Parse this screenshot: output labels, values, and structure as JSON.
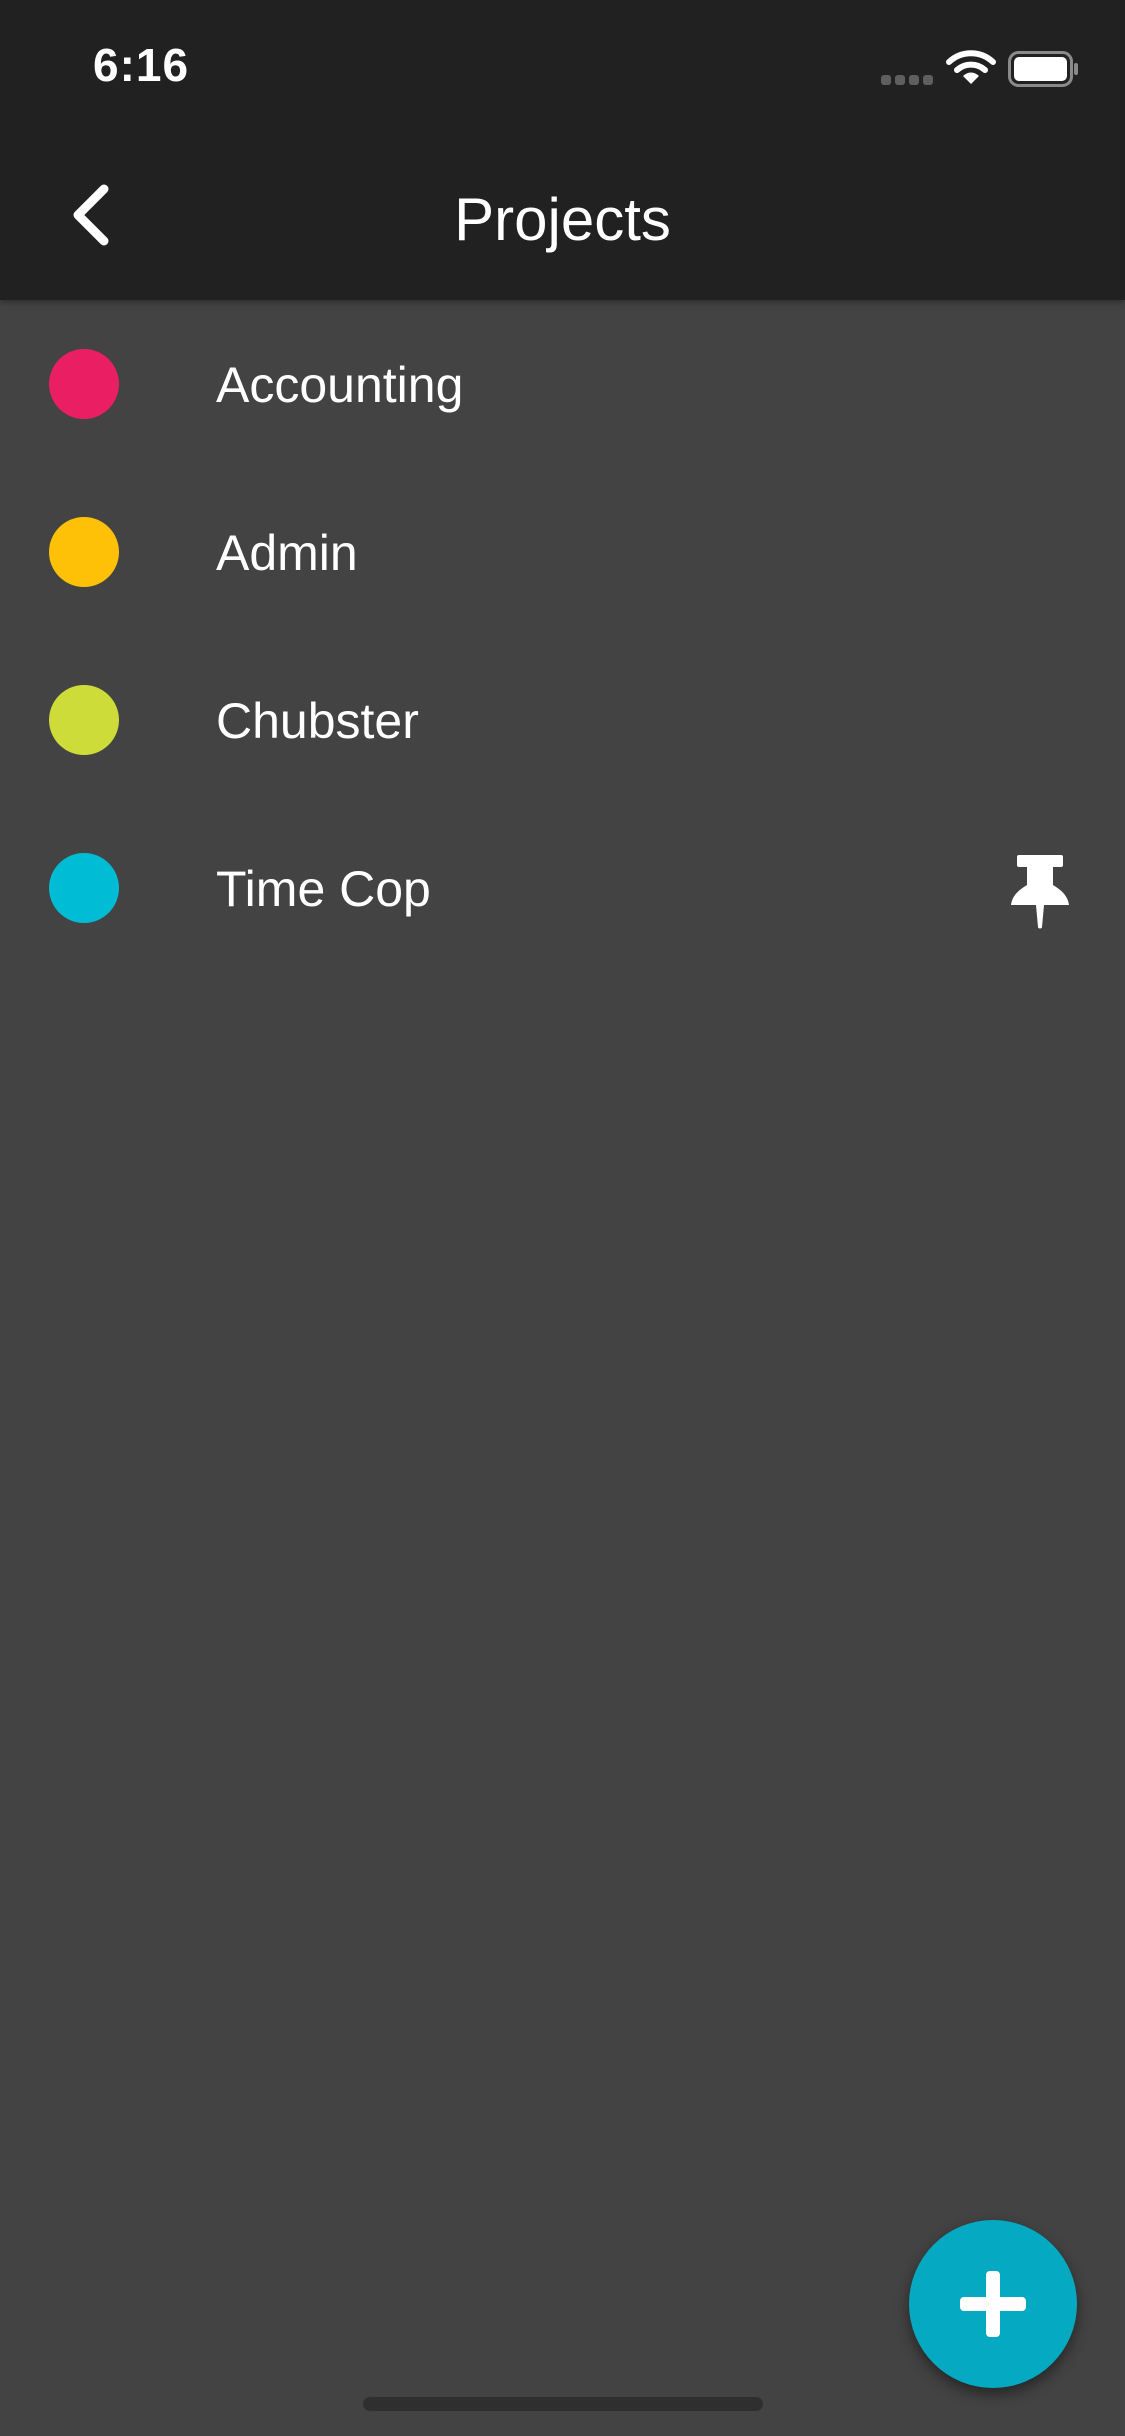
{
  "status_bar": {
    "time": "6:16"
  },
  "header": {
    "title": "Projects",
    "back_icon": "chevron-left-icon"
  },
  "projects": [
    {
      "name": "Accounting",
      "color": "#e91e63",
      "pinned": false
    },
    {
      "name": "Admin",
      "color": "#ffc107",
      "pinned": false
    },
    {
      "name": "Chubster",
      "color": "#cddc39",
      "pinned": false
    },
    {
      "name": "Time Cop",
      "color": "#00bcd4",
      "pinned": true
    }
  ],
  "fab": {
    "icon": "plus-icon",
    "color": "#06a9c2"
  },
  "colors": {
    "header_bg": "#212121",
    "body_bg": "#434343",
    "text": "#ffffff"
  }
}
